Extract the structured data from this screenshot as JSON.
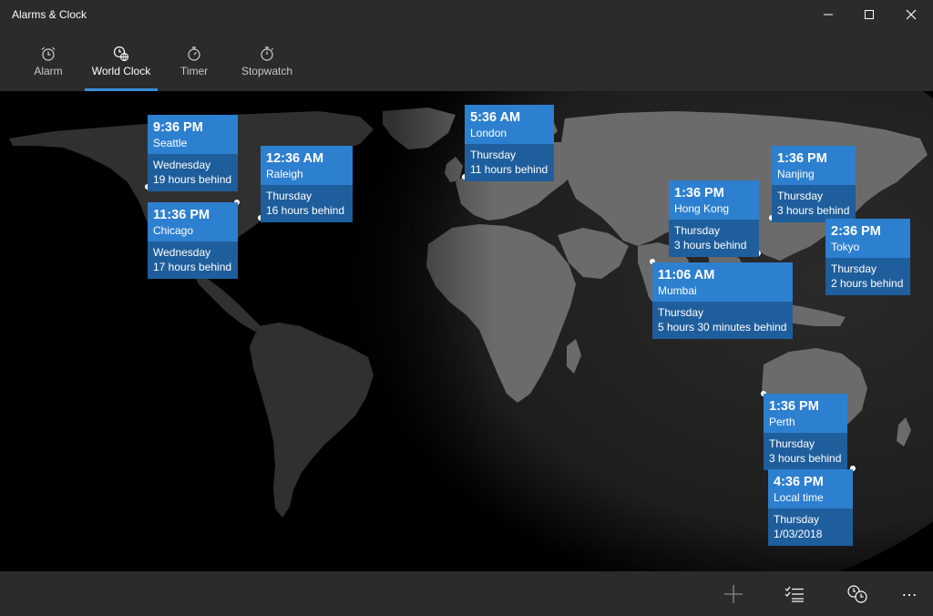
{
  "window": {
    "title": "Alarms & Clock"
  },
  "tabs": [
    {
      "label": "Alarm",
      "icon": "alarm-clock-icon",
      "active": false
    },
    {
      "label": "World Clock",
      "icon": "world-clock-icon",
      "active": true
    },
    {
      "label": "Timer",
      "icon": "timer-icon",
      "active": false
    },
    {
      "label": "Stopwatch",
      "icon": "stopwatch-icon",
      "active": false
    }
  ],
  "clocks": [
    {
      "time": "9:36 PM",
      "city": "Seattle",
      "day": "Wednesday",
      "diff": "19 hours behind"
    },
    {
      "time": "12:36 AM",
      "city": "Raleigh",
      "day": "Thursday",
      "diff": "16 hours behind"
    },
    {
      "time": "11:36 PM",
      "city": "Chicago",
      "day": "Wednesday",
      "diff": "17 hours behind"
    },
    {
      "time": "5:36 AM",
      "city": "London",
      "day": "Thursday",
      "diff": "11 hours behind"
    },
    {
      "time": "1:36 PM",
      "city": "Hong Kong",
      "day": "Thursday",
      "diff": "3 hours behind"
    },
    {
      "time": "1:36 PM",
      "city": "Nanjing",
      "day": "Thursday",
      "diff": "3 hours behind"
    },
    {
      "time": "2:36 PM",
      "city": "Tokyo",
      "day": "Thursday",
      "diff": "2 hours behind"
    },
    {
      "time": "11:06 AM",
      "city": "Mumbai",
      "day": "Thursday",
      "diff": "5 hours 30 minutes behind"
    },
    {
      "time": "1:36 PM",
      "city": "Perth",
      "day": "Thursday",
      "diff": "3 hours behind"
    },
    {
      "time": "4:36 PM",
      "city": "Local time",
      "day": "Thursday",
      "diff": "1/03/2018"
    }
  ],
  "commands": {
    "add": "add-icon",
    "select": "select-list-icon",
    "compare": "compare-time-icon",
    "more": "more-icon"
  },
  "colors": {
    "accent": "#2d7fd0",
    "accent_dark": "#1f5e9c",
    "chrome": "#2b2b2b"
  }
}
